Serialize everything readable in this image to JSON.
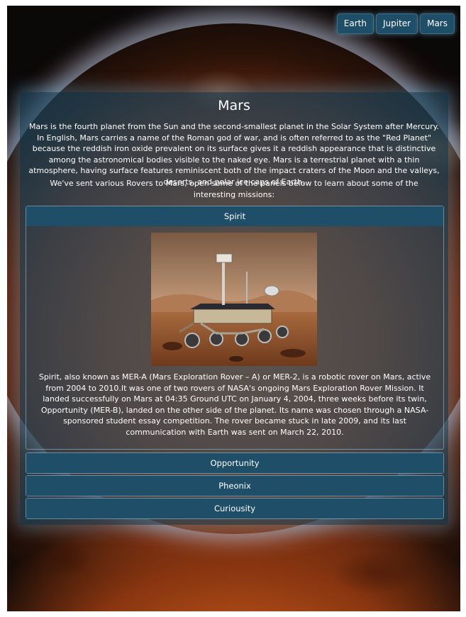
{
  "nav": {
    "items": [
      "Earth",
      "Jupiter",
      "Mars"
    ]
  },
  "main": {
    "title": "Mars",
    "intro": "Mars is the fourth planet from the Sun and the second-smallest planet in the Solar System after Mercury. In English, Mars carries a name of the Roman god of war, and is often referred to as the \"Red Planet\" because the reddish iron oxide prevalent on its surface gives it a reddish appearance that is distinctive among the astronomical bodies visible to the naked eye. Mars is a terrestrial planet with a thin atmosphere, having surface features reminiscent both of the impact craters of the Moon and the valleys, deserts, and polar ice caps of Earth.",
    "rovers_intro": "We've sent various Rovers to Mars, open some of the panels below to learn about some of the interesting missions:"
  },
  "accordion": [
    {
      "title": "Spirit",
      "expanded": true,
      "image": "rover-photo",
      "description": "Spirit, also known as MER-A (Mars Exploration Rover – A) or MER-2, is a robotic rover on Mars, active from 2004 to 2010.It was one of two rovers of NASA's ongoing Mars Exploration Rover Mission. It landed successfully on Mars at 04:35 Ground UTC on January 4, 2004, three weeks before its twin, Opportunity (MER-B), landed on the other side of the planet. Its name was chosen through a NASA-sponsored student essay competition. The rover became stuck in late 2009, and its last communication with Earth was sent on March 22, 2010."
    },
    {
      "title": "Opportunity",
      "expanded": false
    },
    {
      "title": "Pheonix",
      "expanded": false
    },
    {
      "title": "Curiousity",
      "expanded": false
    }
  ],
  "colors": {
    "accent": "#1f4e68",
    "panel": "#1c4a64",
    "text": "#ffffff"
  }
}
